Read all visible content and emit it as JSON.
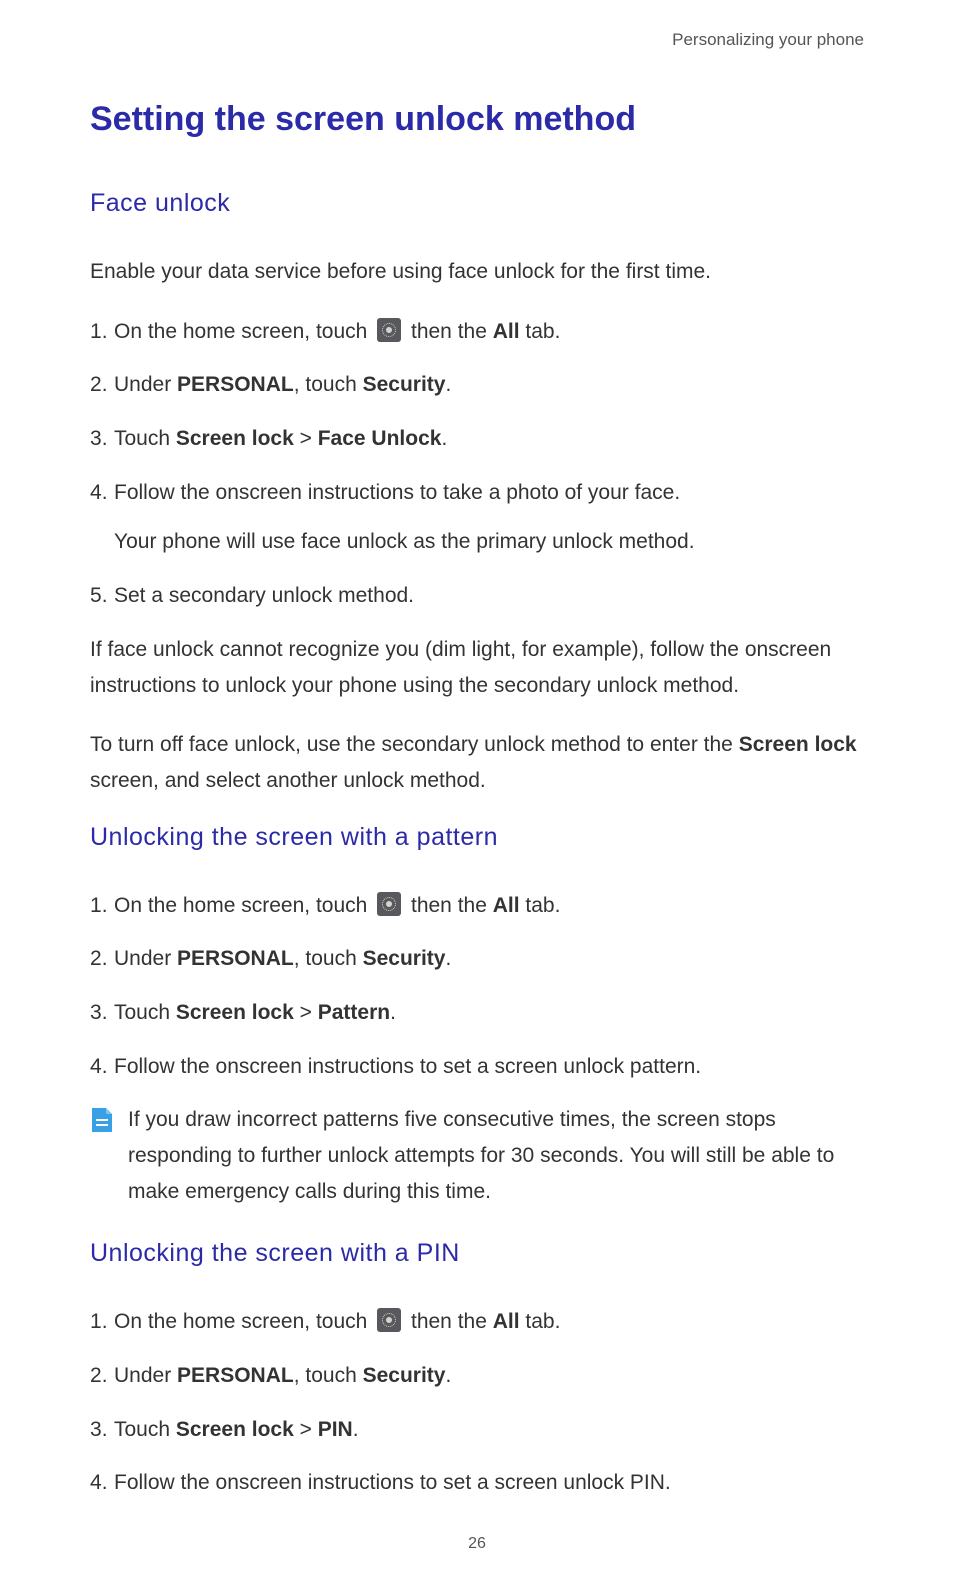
{
  "header": {
    "breadcrumb": "Personalizing your phone"
  },
  "title": "Setting the screen unlock method",
  "sections": {
    "face_unlock": {
      "heading": "Face  unlock",
      "intro": "Enable your data service before using face unlock for the first time.",
      "steps": {
        "s1_pre": "On the home screen, touch ",
        "s1_post": " then the ",
        "s1_bold": "All",
        "s1_tail": " tab.",
        "s2_pre": "Under ",
        "s2_b1": "PERSONAL",
        "s2_mid": ", touch ",
        "s2_b2": "Security",
        "s2_tail": ".",
        "s3_pre": "Touch ",
        "s3_b1": "Screen lock",
        "s3_mid": " > ",
        "s3_b2": "Face Unlock",
        "s3_tail": ".",
        "s4": "Follow the onscreen instructions to take a photo of your face.",
        "s4_sub": "Your phone will use face unlock as the primary unlock method.",
        "s5": "Set a secondary unlock method."
      },
      "para1": "If face unlock cannot recognize you (dim light, for example), follow the onscreen instructions to unlock your phone using the secondary unlock method.",
      "para2_pre": "To turn off face unlock, use the secondary unlock method to enter the ",
      "para2_b": "Screen lock",
      "para2_post": " screen, and select another unlock method."
    },
    "pattern": {
      "heading": "Unlocking  the  screen  with  a  pattern",
      "steps": {
        "s1_pre": "On the home screen, touch ",
        "s1_post": " then the ",
        "s1_bold": "All",
        "s1_tail": " tab.",
        "s2_pre": "Under ",
        "s2_b1": "PERSONAL",
        "s2_mid": ", touch ",
        "s2_b2": "Security",
        "s2_tail": ".",
        "s3_pre": "Touch ",
        "s3_b1": "Screen lock",
        "s3_mid": " > ",
        "s3_b2": "Pattern",
        "s3_tail": ".",
        "s4": "Follow the onscreen instructions to set a screen unlock pattern."
      },
      "note": "If you draw incorrect patterns five consecutive times, the screen stops responding to further unlock attempts for 30 seconds. You will still be able to make emergency calls during this time."
    },
    "pin": {
      "heading": "Unlocking  the  screen  with  a  PIN",
      "steps": {
        "s1_pre": "On the home screen, touch ",
        "s1_post": " then the ",
        "s1_bold": "All",
        "s1_tail": " tab.",
        "s2_pre": "Under ",
        "s2_b1": "PERSONAL",
        "s2_mid": ", touch ",
        "s2_b2": "Security",
        "s2_tail": ".",
        "s3_pre": "Touch ",
        "s3_b1": "Screen lock",
        "s3_mid": " > ",
        "s3_b2": "PIN",
        "s3_tail": ".",
        "s4": "Follow the onscreen instructions to set a screen unlock PIN."
      }
    }
  },
  "icons": {
    "settings": "settings-gear"
  },
  "page_number": "26"
}
